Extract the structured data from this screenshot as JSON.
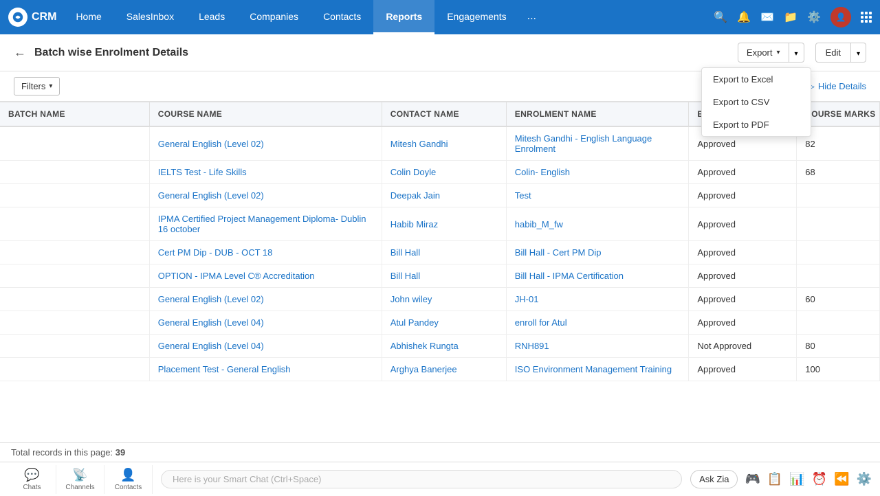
{
  "app": {
    "logo_text": "CRM",
    "nav_items": [
      {
        "label": "Home",
        "active": false
      },
      {
        "label": "SalesInbox",
        "active": false
      },
      {
        "label": "Leads",
        "active": false
      },
      {
        "label": "Companies",
        "active": false
      },
      {
        "label": "Contacts",
        "active": false
      },
      {
        "label": "Reports",
        "active": true
      },
      {
        "label": "Engagements",
        "active": false
      },
      {
        "label": "...",
        "active": false
      }
    ]
  },
  "page": {
    "title": "Batch wise Enrolment Details",
    "back_label": "←"
  },
  "toolbar": {
    "export_label": "Export",
    "edit_label": "Edit",
    "filters_label": "Filters",
    "hide_details_label": "Hide Details"
  },
  "export_dropdown": {
    "items": [
      {
        "label": "Export to Excel"
      },
      {
        "label": "Export to CSV"
      },
      {
        "label": "Export to PDF"
      }
    ]
  },
  "table": {
    "columns": [
      {
        "key": "batch_name",
        "label": "BATCH NAME"
      },
      {
        "key": "course_name",
        "label": "COURSE NAME"
      },
      {
        "key": "contact_name",
        "label": "CONTACT NAME"
      },
      {
        "key": "enrolment_name",
        "label": "ENROLMENT NAME"
      },
      {
        "key": "enrolment_status",
        "label": "ENROLMENT STATUS"
      },
      {
        "key": "course_marks",
        "label": "COURSE MARKS"
      }
    ],
    "rows": [
      {
        "batch_name": "",
        "course_name": "General English (Level 02)",
        "contact_name": "Mitesh Gandhi",
        "enrolment_name": "Mitesh Gandhi - English Language Enrolment",
        "enrolment_status": "Approved",
        "course_marks": "82"
      },
      {
        "batch_name": "",
        "course_name": "IELTS Test - Life Skills",
        "contact_name": "Colin Doyle",
        "enrolment_name": "Colin- English",
        "enrolment_status": "Approved",
        "course_marks": "68"
      },
      {
        "batch_name": "",
        "course_name": "General English (Level 02)",
        "contact_name": "Deepak Jain",
        "enrolment_name": "Test",
        "enrolment_status": "Approved",
        "course_marks": ""
      },
      {
        "batch_name": "",
        "course_name": "IPMA Certified Project Management Diploma- Dublin 16 october",
        "contact_name": "Habib Miraz",
        "enrolment_name": "habib_M_fw",
        "enrolment_status": "Approved",
        "course_marks": ""
      },
      {
        "batch_name": "",
        "course_name": "Cert PM Dip - DUB - OCT 18",
        "contact_name": "Bill Hall",
        "enrolment_name": "Bill Hall - Cert PM Dip",
        "enrolment_status": "Approved",
        "course_marks": ""
      },
      {
        "batch_name": "",
        "course_name": "OPTION - IPMA Level C® Accreditation",
        "contact_name": "Bill Hall",
        "enrolment_name": "Bill Hall - IPMA Certification",
        "enrolment_status": "Approved",
        "course_marks": ""
      },
      {
        "batch_name": "",
        "course_name": "General English (Level 02)",
        "contact_name": "John wiley",
        "enrolment_name": "JH-01",
        "enrolment_status": "Approved",
        "course_marks": "60"
      },
      {
        "batch_name": "",
        "course_name": "General English (Level 04)",
        "contact_name": "Atul Pandey",
        "enrolment_name": "enroll for Atul",
        "enrolment_status": "Approved",
        "course_marks": ""
      },
      {
        "batch_name": "",
        "course_name": "General English (Level 04)",
        "contact_name": "Abhishek Rungta",
        "enrolment_name": "RNH891",
        "enrolment_status": "Not Approved",
        "course_marks": "80"
      },
      {
        "batch_name": "",
        "course_name": "Placement Test - General English",
        "contact_name": "Arghya Banerjee",
        "enrolment_name": "ISO Environment Management Training",
        "enrolment_status": "Approved",
        "course_marks": "100"
      }
    ]
  },
  "footer": {
    "total_label": "Total records in this page:",
    "total_count": "39"
  },
  "bottom_bar": {
    "icons": [
      {
        "label": "Chats",
        "icon": "💬"
      },
      {
        "label": "Channels",
        "icon": "📡"
      },
      {
        "label": "Contacts",
        "icon": "👤"
      }
    ],
    "smart_chat_placeholder": "Here is your Smart Chat (Ctrl+Space)",
    "ask_zia_label": "Ask Zia",
    "action_icons": [
      "🎮",
      "📋",
      "📊",
      "⏰",
      "⏪",
      "⚙️"
    ]
  }
}
